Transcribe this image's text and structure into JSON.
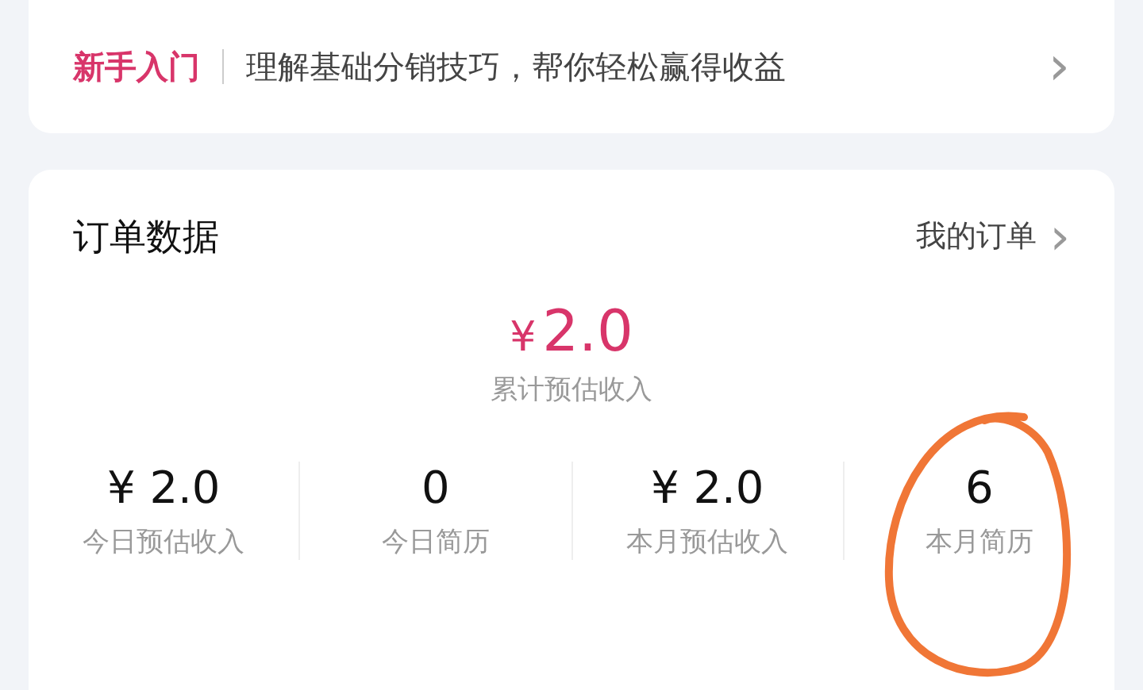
{
  "guide": {
    "tag": "新手入门",
    "text": "理解基础分销技巧，帮你轻松赢得收益",
    "arrow": "›"
  },
  "orders": {
    "title": "订单数据",
    "link": "我的订单",
    "link_arrow": "›",
    "total": {
      "currency": "¥",
      "value": "2.0",
      "label": "累计预估收入"
    },
    "stats": [
      {
        "value": "¥ 2.0",
        "label": "今日预估收入"
      },
      {
        "value": "0",
        "label": "今日简历"
      },
      {
        "value": "¥ 2.0",
        "label": "本月预估收入"
      },
      {
        "value": "6",
        "label": "本月简历"
      }
    ]
  }
}
